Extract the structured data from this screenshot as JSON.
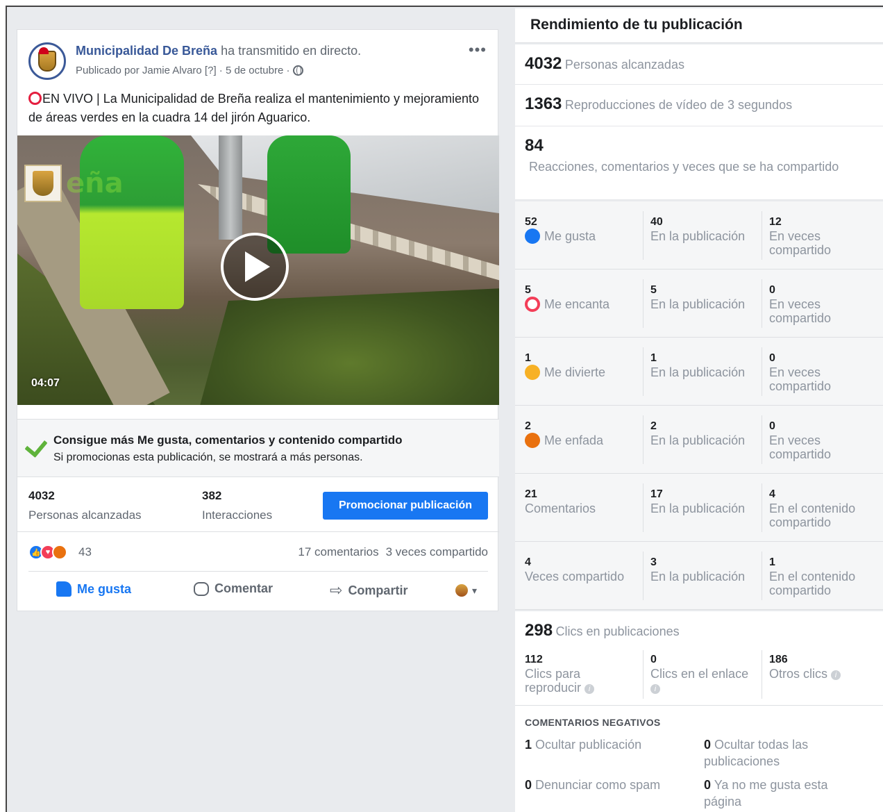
{
  "post": {
    "page_name": "Municipalidad De Breña",
    "action_text": "ha transmitido en directo.",
    "published_by": "Publicado por Jamie Alvaro [?] · 5 de octubre ·",
    "more_icon": "more-dots-icon",
    "text": "EN VIVO | La Municipalidad de Breña realiza el mantenimiento y mejoramiento de áreas verdes en la cuadra 14 del jirón Aguarico.",
    "video": {
      "duration": "04:07",
      "watermark": "eña"
    },
    "promo": {
      "title": "Consigue más Me gusta, comentarios y contenido compartido",
      "subtitle": "Si promocionas esta publicación, se mostrará a más personas."
    },
    "stats": {
      "reach_value": "4032",
      "reach_label": "Personas alcanzadas",
      "interactions_value": "382",
      "interactions_label": "Interacciones",
      "promote_button": "Promocionar publicación"
    },
    "reactions": {
      "count": "43",
      "comments": "17 comentarios",
      "shares": "3 veces compartido"
    },
    "actions": {
      "like": "Me gusta",
      "comment": "Comentar",
      "share": "Compartir"
    }
  },
  "panel": {
    "title": "Rendimiento de tu publicación",
    "reach": {
      "value": "4032",
      "label": "Personas alcanzadas"
    },
    "views": {
      "value": "1363",
      "label": "Reproducciones de vídeo de 3 segundos"
    },
    "engagement": {
      "value": "84",
      "label": "Reacciones, comentarios y veces que se ha compartido"
    },
    "rows": [
      {
        "total": "52",
        "name": "Me gusta",
        "emoji": "like",
        "on_post": "40",
        "on_post_label": "En la publicación",
        "shared": "12",
        "shared_label": "En veces compartido"
      },
      {
        "total": "5",
        "name": "Me encanta",
        "emoji": "love",
        "on_post": "5",
        "on_post_label": "En la publicación",
        "shared": "0",
        "shared_label": "En veces compartido"
      },
      {
        "total": "1",
        "name": "Me divierte",
        "emoji": "haha",
        "on_post": "1",
        "on_post_label": "En la publicación",
        "shared": "0",
        "shared_label": "En veces compartido"
      },
      {
        "total": "2",
        "name": "Me enfada",
        "emoji": "angry",
        "on_post": "2",
        "on_post_label": "En la publicación",
        "shared": "0",
        "shared_label": "En veces compartido"
      },
      {
        "total": "21",
        "name": "Comentarios",
        "emoji": "",
        "on_post": "17",
        "on_post_label": "En la publicación",
        "shared": "4",
        "shared_label": "En el contenido compartido"
      },
      {
        "total": "4",
        "name": "Veces compartido",
        "emoji": "",
        "on_post": "3",
        "on_post_label": "En la publicación",
        "shared": "1",
        "shared_label": "En el contenido compartido"
      }
    ],
    "clicks": {
      "value": "298",
      "label": "Clics en publicaciones",
      "play_value": "112",
      "play_label": "Clics para reproducir",
      "link_value": "0",
      "link_label": "Clics en el enlace",
      "other_value": "186",
      "other_label": "Otros clics"
    },
    "negative": {
      "title": "COMENTARIOS NEGATIVOS",
      "hide_post_value": "1",
      "hide_post_label": "Ocultar publicación",
      "hide_all_value": "0",
      "hide_all_label": "Ocultar todas las publicaciones",
      "spam_value": "0",
      "spam_label": "Denunciar como spam",
      "unlike_value": "0",
      "unlike_label": "Ya no me gusta esta página"
    }
  },
  "colors": {
    "link_blue": "#385898",
    "button_blue": "#1877f2",
    "live_red": "#e41e3f",
    "promo_green": "#5fb33b"
  }
}
